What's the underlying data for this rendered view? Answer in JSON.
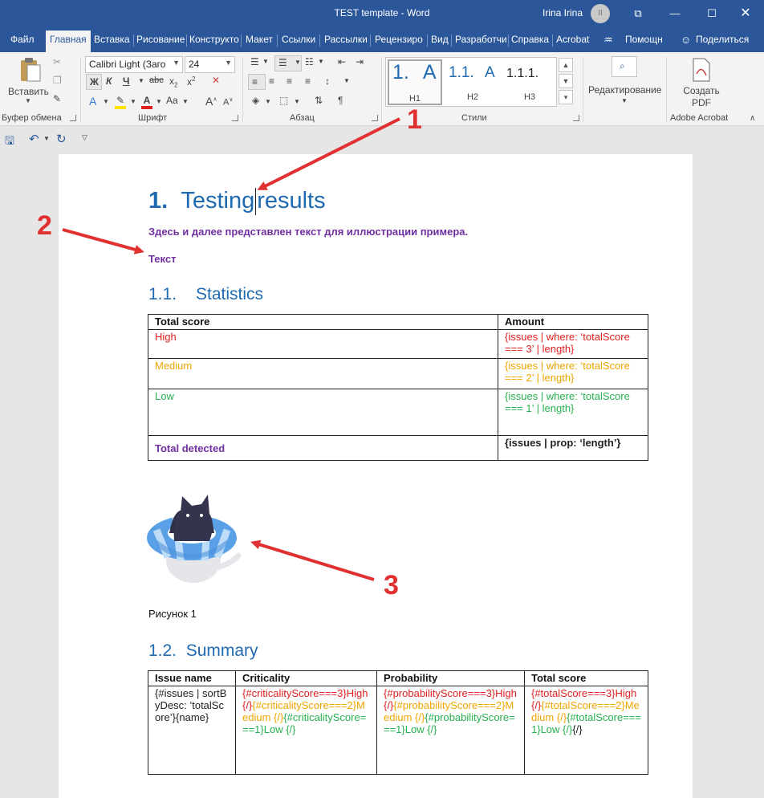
{
  "window": {
    "title": "TEST template  -  Word",
    "user": "Irina Irina",
    "avatar_initials": "II"
  },
  "tabs": [
    "Файл",
    "Главная",
    "Вставка",
    "Рисование",
    "Конструкто",
    "Макет",
    "Ссылки",
    "Рассылки",
    "Рецензиро",
    "Вид",
    "Разработчи",
    "Справка",
    "Acrobat"
  ],
  "tab_extras": {
    "help": "Помощн",
    "share": "Поделиться"
  },
  "ribbon": {
    "paste": "Вставить",
    "clipboard_label": "Буфер обмена",
    "font_name": "Calibri Light (Заго",
    "font_size": "24",
    "font_label": "Шрифт",
    "paragraph_label": "Абзац",
    "styles_label": "Стили",
    "styles": [
      {
        "sample_num": "1.",
        "sample_letter": "A",
        "name": "H1"
      },
      {
        "sample_num": "1.1.",
        "sample_letter": "A",
        "name": "H2"
      },
      {
        "sample_num": "1.1.1.",
        "sample_letter": "",
        "name": "H3"
      }
    ],
    "editing": "Редактирование",
    "create_pdf": "Создать PDF",
    "adobe_label": "Adobe Acrobat"
  },
  "document": {
    "h1_num": "1.",
    "h1_text_a": "Testing",
    "h1_text_b": "results",
    "intro": "Здесь и далее представлен текст для иллюстрации примера.",
    "tekst": "Текст",
    "h2_stats_num": "1.1.",
    "h2_stats_text": "Statistics",
    "stats_headers": [
      "Total score",
      "Amount"
    ],
    "stats_rows": [
      {
        "label": "High",
        "value": "{issues | where: ‘totalScore === 3’ | length}",
        "class": "red"
      },
      {
        "label": "Medium",
        "value": "{issues | where: ‘totalScore === 2’ | length}",
        "class": "orange"
      },
      {
        "label": "Low",
        "value": "{issues | where: ‘totalScore === 1’ | length}",
        "class": "green"
      },
      {
        "label": "Total detected",
        "value": "{issues | prop: ‘length’}",
        "class": "total"
      }
    ],
    "caption": "Рисунок 1",
    "h2_summary_num": "1.2.",
    "h2_summary_text": "Summary",
    "summary_headers": [
      "Issue name",
      "Criticality",
      "Probability",
      "Total score"
    ],
    "summary_row": {
      "issue": "{#issues | sortByDesc: ’totalScore’}{name}",
      "criticality": [
        {
          "t": "{#criticalityScore===3}High {/}",
          "c": "red"
        },
        {
          "t": "{#criticalityScore===2}Medium {/}",
          "c": "orange"
        },
        {
          "t": "{#criticalityScore===1}Low {/}",
          "c": "green"
        }
      ],
      "probability": [
        {
          "t": "{#probabilityScore===3}High {/}",
          "c": "red"
        },
        {
          "t": "{#probabilityScore===2}Medium {/}",
          "c": "orange"
        },
        {
          "t": "{#probabilityScore===1}Low {/}",
          "c": "green"
        }
      ],
      "total": [
        {
          "t": "{#totalScore===3}High {/}",
          "c": "red"
        },
        {
          "t": "{#totalScore===2}Medium {/}",
          "c": "orange"
        },
        {
          "t": "{#totalScore===1}Low {/}",
          "c": "green"
        },
        {
          "t": "{/}",
          "c": "black"
        }
      ]
    }
  },
  "annotations": [
    "1",
    "2",
    "3"
  ],
  "colors": {
    "accent": "#2b579a",
    "heading": "#1f6ab0",
    "purple": "#7030a0",
    "high": "#e02020",
    "medium": "#f0a500",
    "low": "#27b04f",
    "arrow": "#e03030"
  }
}
